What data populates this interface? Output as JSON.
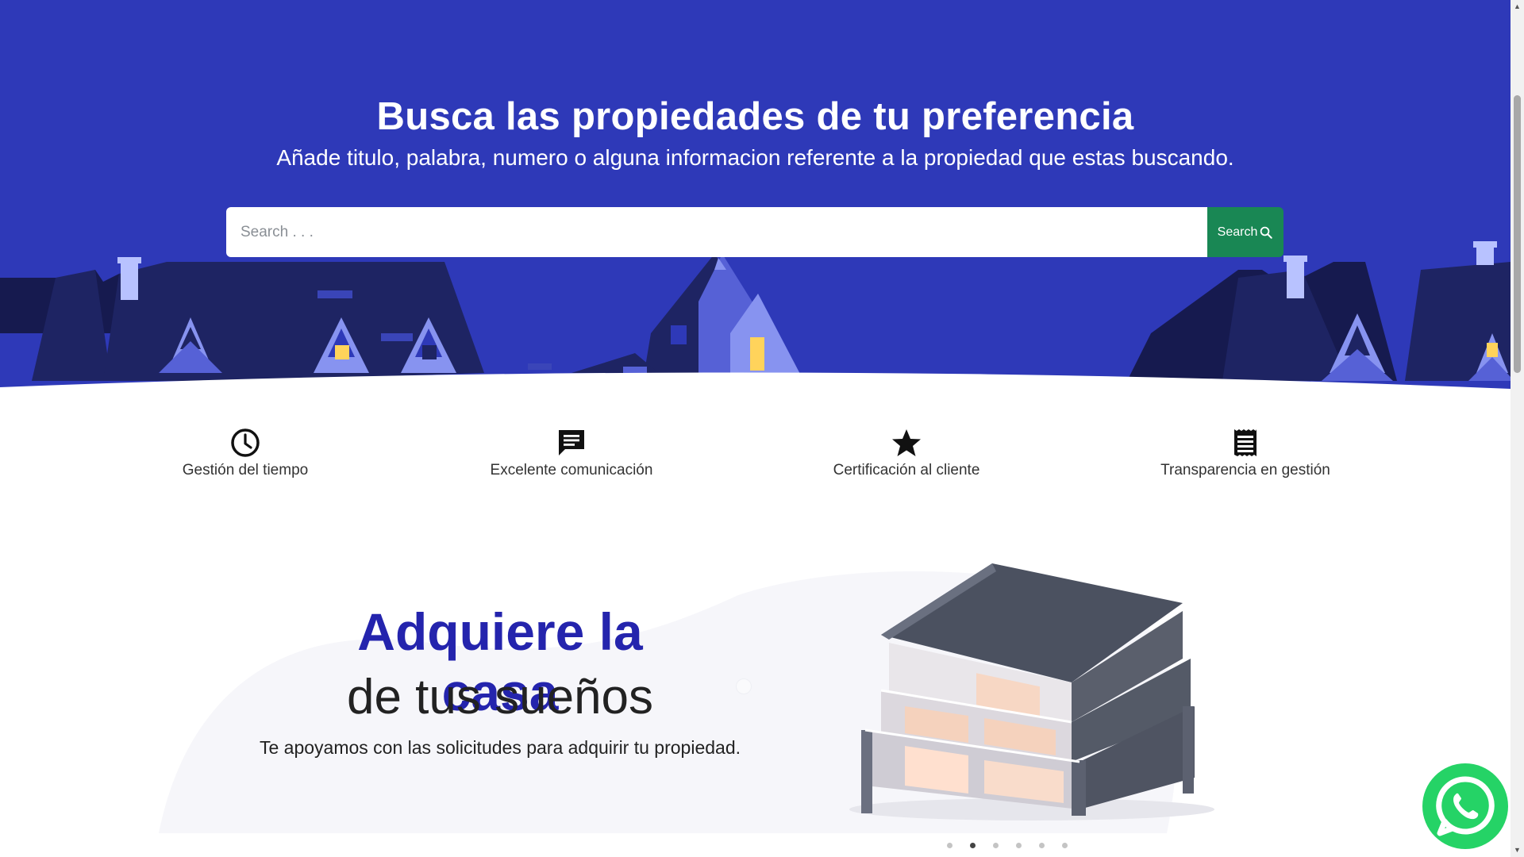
{
  "hero": {
    "title": "Busca las propiedades de tu preferencia",
    "subtitle": "Añade titulo, palabra, numero o alguna informacion referente a la propiedad que estas buscando."
  },
  "search": {
    "placeholder": "Search . . .",
    "value": "",
    "button_label": "Search",
    "button_icon": "search-icon"
  },
  "features": [
    {
      "label": "Gestión del tiempo",
      "icon": "clock-icon"
    },
    {
      "label": "Excelente comunicación",
      "icon": "message-icon"
    },
    {
      "label": "Certificación al cliente",
      "icon": "star-icon"
    },
    {
      "label": "Transparencia en gestión",
      "icon": "receipt-icon"
    }
  ],
  "promo": {
    "title_line1": "Adquiere la casa",
    "title_line2": "de tus sueños",
    "description": "Te apoyamos con las solicitudes para adquirir tu propiedad."
  },
  "carousel": {
    "slide_count": 6,
    "active_index": 1
  },
  "colors": {
    "hero_background": "#2e39b8",
    "accent_blue": "#2424ad",
    "search_button": "#198754",
    "whatsapp": "#25d366"
  }
}
